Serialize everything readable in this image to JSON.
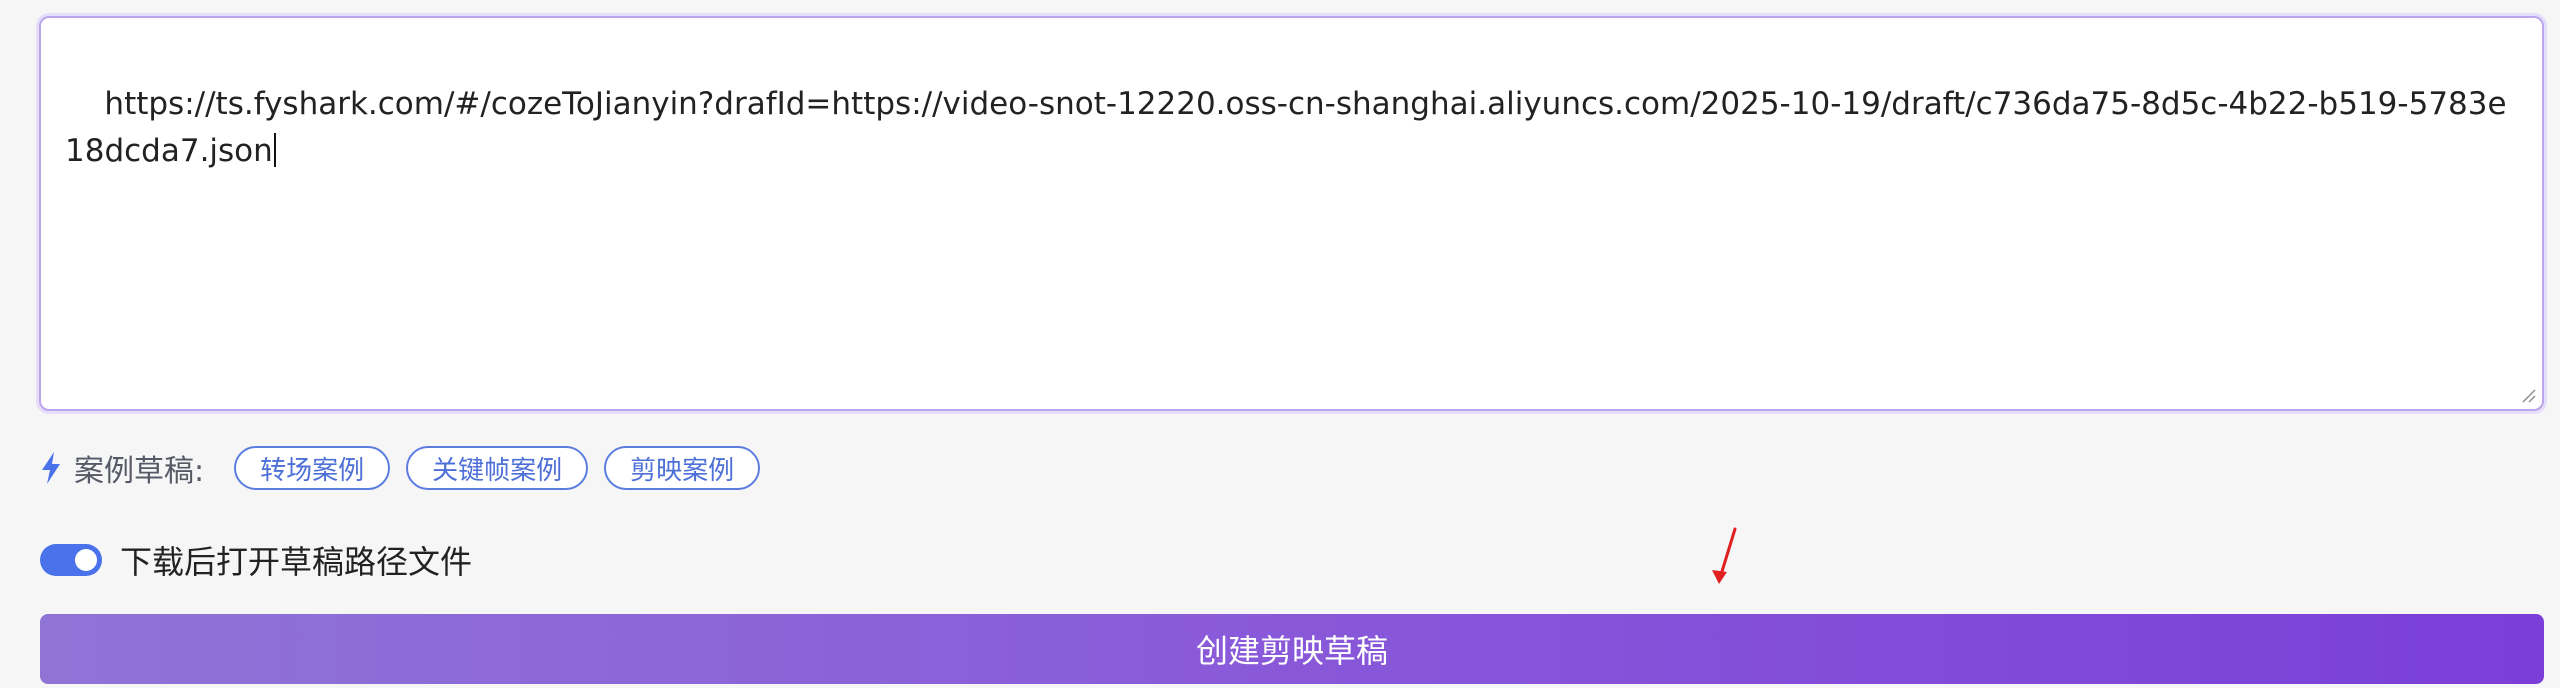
{
  "url_input": {
    "value": "https://ts.fyshark.com/#/cozeToJianyin?drafId=https://video-snot-12220.oss-cn-shanghai.aliyuncs.com/2025-10-19/draft/c736da75-8d5c-4b22-b519-5783e18dcda7.json"
  },
  "examples": {
    "icon": "lightning-bolt-icon",
    "label": "案例草稿:",
    "items": [
      "转场案例",
      "关键帧案例",
      "剪映案例"
    ]
  },
  "open_after_download": {
    "label": "下载后打开草稿路径文件",
    "enabled": true
  },
  "create_button": {
    "label": "创建剪映草稿"
  },
  "colors": {
    "accent_blue": "#4a72ea",
    "chip_border": "#5b7de0",
    "button_gradient_start": "#8f74d6",
    "button_gradient_end": "#7b3ed8",
    "annotation_red": "#e02020"
  }
}
